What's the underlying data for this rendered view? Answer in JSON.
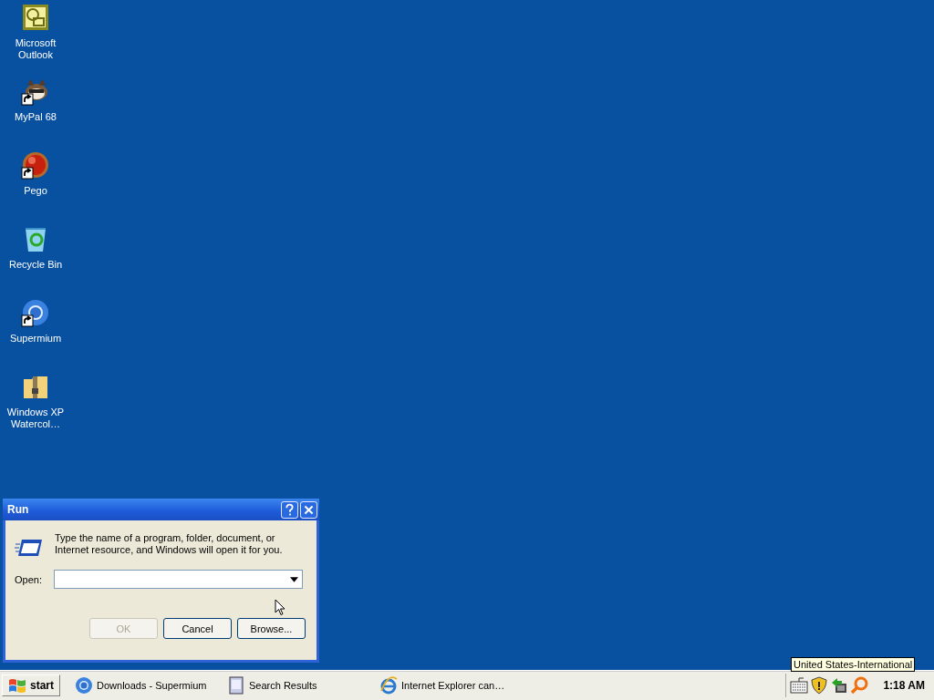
{
  "desktop_icons": [
    {
      "label": "Microsoft Outlook",
      "kind": "outlook",
      "shortcut": false
    },
    {
      "label": "MyPal 68",
      "kind": "raccoon",
      "shortcut": true
    },
    {
      "label": "Pego",
      "kind": "ball",
      "shortcut": true
    },
    {
      "label": "Recycle Bin",
      "kind": "recycle",
      "shortcut": false
    },
    {
      "label": "Supermium",
      "kind": "browser",
      "shortcut": true
    },
    {
      "label": "Windows XP Watercol…",
      "kind": "zip",
      "shortcut": false
    }
  ],
  "run_dialog": {
    "title": "Run",
    "message": "Type the name of a program, folder, document, or Internet resource, and Windows will open it for you.",
    "open_label": "Open:",
    "buttons": [
      {
        "label": "OK",
        "disabled": true
      },
      {
        "label": "Cancel",
        "disabled": false
      },
      {
        "label": "Browse...",
        "disabled": false
      }
    ]
  },
  "taskbar": {
    "start": "start",
    "tasks": [
      {
        "label": "Downloads - Supermium",
        "kind": "browser"
      },
      {
        "label": "Search Results",
        "kind": "search"
      },
      {
        "label": "Internet Explorer can…",
        "kind": "ie"
      }
    ],
    "tooltip": "United States-International",
    "clock": "1:18 AM"
  }
}
